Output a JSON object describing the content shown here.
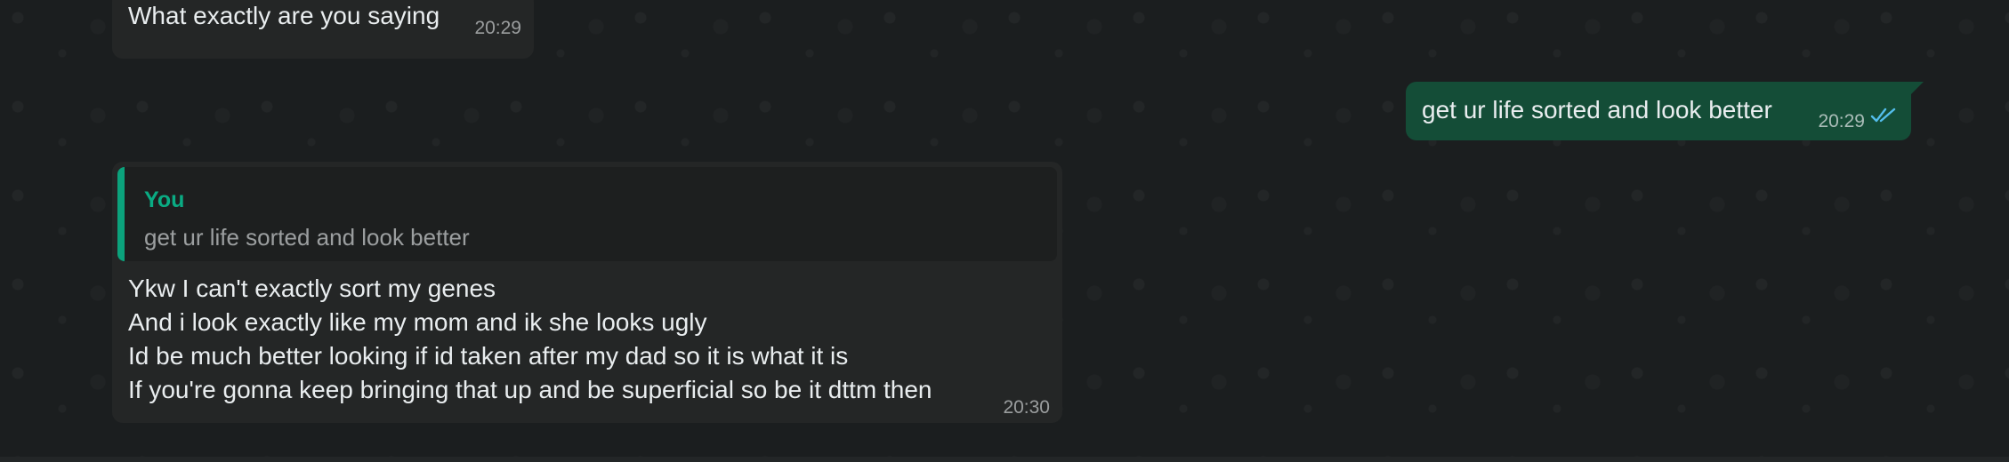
{
  "messages": [
    {
      "direction": "incoming",
      "text": "What exactly are you saying",
      "time": "20:29"
    },
    {
      "direction": "outgoing",
      "text": "get ur life sorted and look better",
      "time": "20:29",
      "status_icon": "double-check-read-icon"
    },
    {
      "direction": "incoming",
      "reply_to": {
        "author": "You",
        "text": "get ur life sorted and look better"
      },
      "lines": [
        "Ykw I can't exactly sort my genes",
        "And i look exactly like my mom and ik she looks ugly",
        "Id be much better looking if id taken after my dad so it is what it is",
        "If you're gonna keep bringing that up and be superficial so be it dttm then"
      ],
      "time": "20:30"
    }
  ],
  "colors": {
    "background": "#1b1e1f",
    "incoming_bubble": "#242626",
    "outgoing_bubble": "#144d37",
    "reply_accent": "#06cf9c",
    "read_ticks": "#53bdeb"
  }
}
